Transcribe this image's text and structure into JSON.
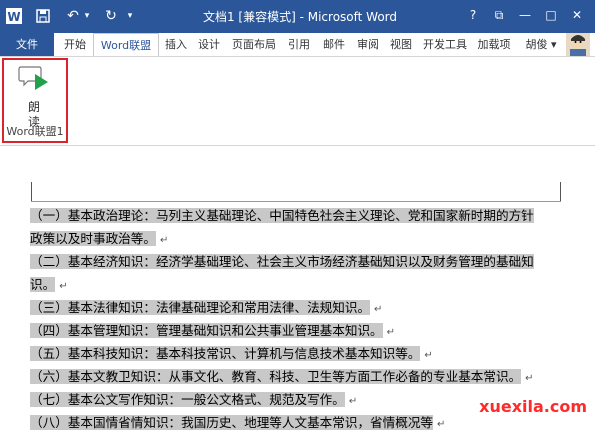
{
  "window": {
    "title": "文档1 [兼容模式] - Microsoft Word",
    "app_icon_letter": "W",
    "help": "?"
  },
  "tabs": [
    {
      "label": "文件"
    },
    {
      "label": "开始"
    },
    {
      "label": "Word联盟"
    },
    {
      "label": "插入"
    },
    {
      "label": "设计"
    },
    {
      "label": "页面布局"
    },
    {
      "label": "引用"
    },
    {
      "label": "邮件"
    },
    {
      "label": "审阅"
    },
    {
      "label": "视图"
    },
    {
      "label": "开发工具"
    },
    {
      "label": "加载项"
    },
    {
      "label": "胡俊 ▾"
    }
  ],
  "ribbon": {
    "read_button": {
      "label_line1": "朗",
      "label_line2": "读"
    },
    "group_label": "Word联盟1"
  },
  "document": {
    "lines": [
      {
        "text": "（一）基本政治理论：马列主义基础理论、中国特色社会主义理论、党和国家新时期的方针",
        "mark": ""
      },
      {
        "text": "政策以及时事政治等。",
        "mark": "↵"
      },
      {
        "text": "（二）基本经济知识：经济学基础理论、社会主义市场经济基础知识以及财务管理的基础知",
        "mark": ""
      },
      {
        "text": "识。",
        "mark": "↵"
      },
      {
        "text": "（三）基本法律知识：法律基础理论和常用法律、法规知识。",
        "mark": "↵"
      },
      {
        "text": "（四）基本管理知识：管理基础知识和公共事业管理基本知识。",
        "mark": "↵"
      },
      {
        "text": "（五）基本科技知识：基本科技常识、计算机与信息技术基本知识等。",
        "mark": "↵"
      },
      {
        "text": "（六）基本文教卫知识：从事文化、教育、科技、卫生等方面工作必备的专业基本常识。",
        "mark": "↵"
      },
      {
        "text": "（七）基本公文写作知识：一般公文格式、规范及写作。",
        "mark": "↵"
      },
      {
        "text": "（八）基本国情省情知识：我国历史、地理等人文基本常识，省情概况等",
        "mark": "↵"
      }
    ]
  },
  "watermark": "xuexila.com"
}
